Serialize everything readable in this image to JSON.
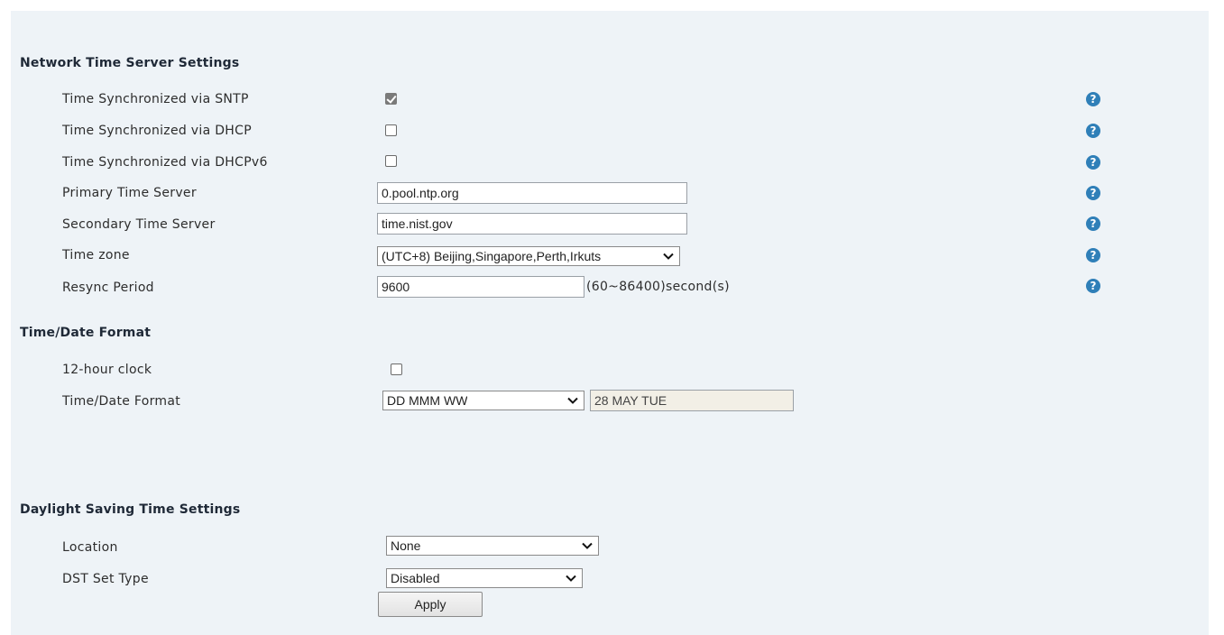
{
  "network_time": {
    "title": "Network Time Server Settings",
    "sntp_label": "Time Synchronized via SNTP",
    "sntp_checked": true,
    "dhcp_label": "Time Synchronized via DHCP",
    "dhcp_checked": false,
    "dhcpv6_label": "Time Synchronized via DHCPv6",
    "dhcpv6_checked": false,
    "primary_label": "Primary Time Server",
    "primary_value": "0.pool.ntp.org",
    "secondary_label": "Secondary Time Server",
    "secondary_value": "time.nist.gov",
    "timezone_label": "Time zone",
    "timezone_value": "(UTC+8) Beijing,Singapore,Perth,Irkuts",
    "resync_label": "Resync Period",
    "resync_value": "9600",
    "resync_hint": "(60~86400)second(s)",
    "help_glyph": "?"
  },
  "time_date_format": {
    "title": "Time/Date Format",
    "clock12_label": "12-hour clock",
    "clock12_checked": false,
    "format_label": "Time/Date Format",
    "format_value": "DD MMM WW",
    "format_preview": "28 MAY TUE"
  },
  "dst": {
    "title": "Daylight Saving Time Settings",
    "location_label": "Location",
    "location_value": "None",
    "type_label": "DST Set Type",
    "type_value": "Disabled"
  },
  "apply_label": "Apply",
  "colors": {
    "panel_bg": "#eef3f7",
    "help_icon": "#2f7fb8"
  },
  "icons": {
    "help": "question-circle-icon",
    "dropdown": "chevron-down-icon",
    "checkbox": "check-icon"
  }
}
